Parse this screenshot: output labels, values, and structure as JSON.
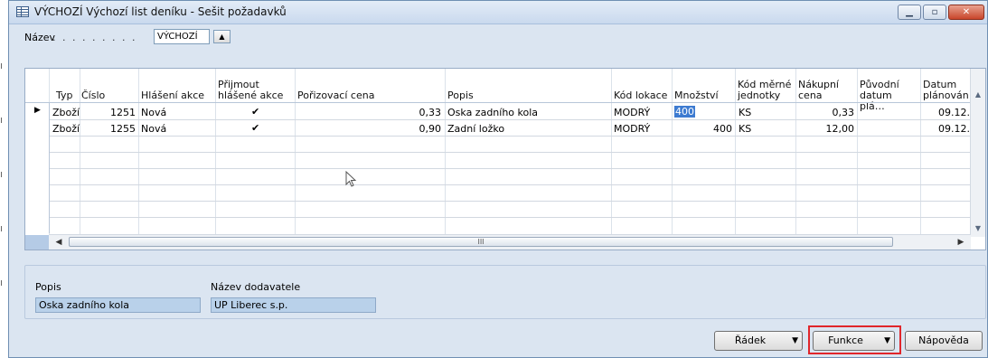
{
  "window": {
    "title": "VÝCHOZÍ Výchozí list deníku - Sešit požadavků",
    "minimize": "▁",
    "maximize": "▫",
    "close": "✕"
  },
  "header": {
    "name_label": "Název",
    "name_dots": ". . . . . . . . .",
    "name_value": "VÝCHOZÍ",
    "lookup_icon": "▲"
  },
  "grid": {
    "columns": [
      "Typ",
      "Číslo",
      "Hlášení akce",
      "Přijmout hlášené akce",
      "Pořizovací cena",
      "Popis",
      "Kód lokace",
      "Množství",
      "Kód měrné jednotky",
      "Nákupní cena",
      "Původní datum plá…",
      "Datum plánován"
    ],
    "rows": [
      {
        "marker": "▶",
        "typ": "Zboží",
        "cislo": "1251",
        "hlaseni": "Nová",
        "prijmout": "✔",
        "porizovaci": "0,33",
        "popis": "Oska zadního kola",
        "lokace": "MODRÝ",
        "mnozstvi": "400",
        "jednotka": "KS",
        "nakupni": "0,33",
        "puvodni": "",
        "datum": "09.12."
      },
      {
        "marker": "",
        "typ": "Zboží",
        "cislo": "1255",
        "hlaseni": "Nová",
        "prijmout": "✔",
        "porizovaci": "0,90",
        "popis": "Zadní ložko",
        "lokace": "MODRÝ",
        "mnozstvi": "400",
        "jednotka": "KS",
        "nakupni": "12,00",
        "puvodni": "",
        "datum": "09.12."
      }
    ],
    "hscroll_mark": "III",
    "left_arrow": "◀",
    "right_arrow": "▶",
    "up_arrow": "▲",
    "down_arrow": "▼"
  },
  "info": {
    "popis_label": "Popis",
    "popis_value": "Oska zadního kola",
    "vendor_label": "Název dodavatele",
    "vendor_value": "UP Liberec s.p."
  },
  "buttons": {
    "radek": "Řádek",
    "funkce": "Funkce",
    "napoveda": "Nápověda",
    "dropdown": "▼"
  },
  "highlight_color": "#e0262b"
}
